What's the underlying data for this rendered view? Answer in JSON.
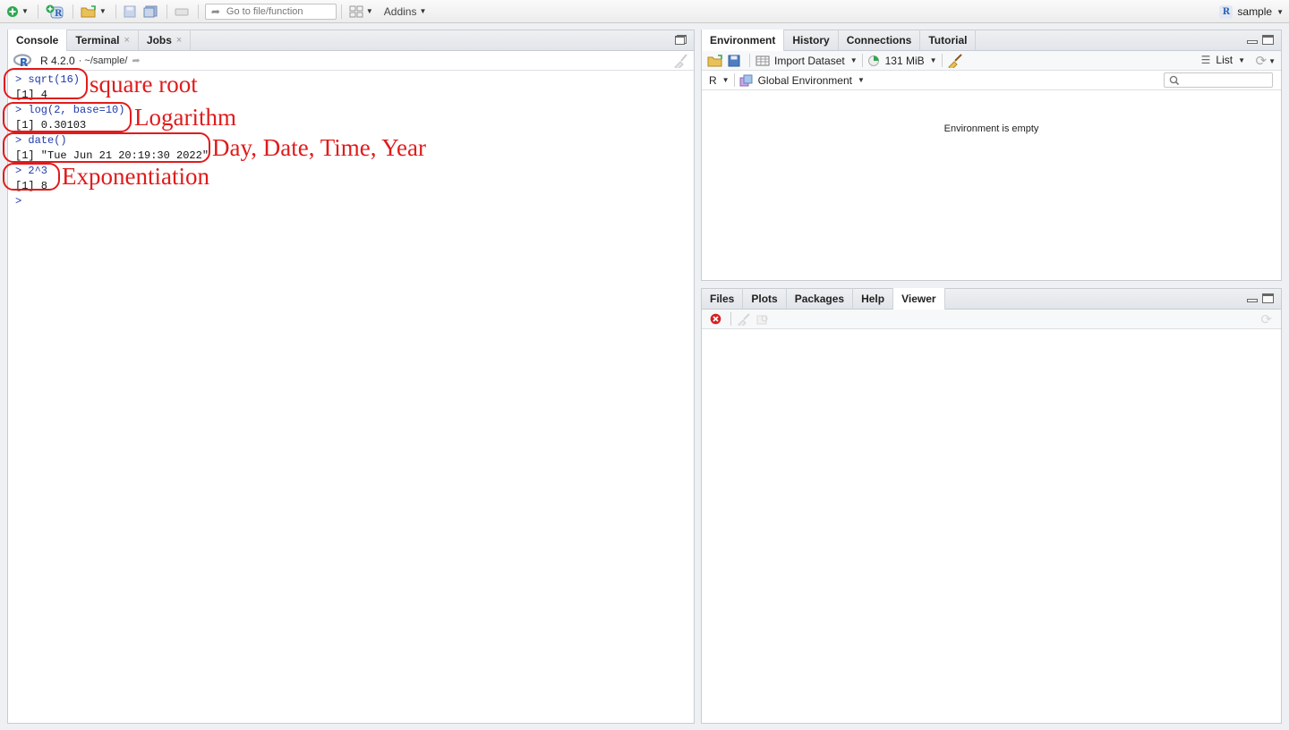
{
  "toolbar": {
    "goto_placeholder": "Go to file/function",
    "addins_label": "Addins",
    "project_label": "sample"
  },
  "console_pane": {
    "tabs": [
      {
        "label": "Console",
        "active": true
      },
      {
        "label": "Terminal",
        "close": "×"
      },
      {
        "label": "Jobs",
        "close": "×"
      }
    ],
    "r_version": "R 4.2.0",
    "working_dir": "· ~/sample/",
    "lines": [
      {
        "cmd": "> sqrt(16)",
        "out": "[1] 4"
      },
      {
        "cmd": "> log(2, base=10)",
        "out": "[1] 0.30103"
      },
      {
        "cmd": "> date()",
        "out": "[1] \"Tue Jun 21 20:19:30 2022\""
      },
      {
        "cmd": "> 2^3",
        "out": "[1] 8"
      }
    ],
    "prompt": ">",
    "annotations": [
      "square root",
      "Logarithm",
      "Day, Date, Time, Year",
      "Exponentiation"
    ]
  },
  "env_pane": {
    "tabs": [
      {
        "label": "Environment",
        "active": true
      },
      {
        "label": "History"
      },
      {
        "label": "Connections"
      },
      {
        "label": "Tutorial"
      }
    ],
    "import_label": "Import Dataset",
    "memory_label": "131 MiB",
    "view_mode": "List",
    "language": "R",
    "scope": "Global Environment",
    "empty_message": "Environment is empty"
  },
  "viewer_pane": {
    "tabs": [
      {
        "label": "Files"
      },
      {
        "label": "Plots"
      },
      {
        "label": "Packages"
      },
      {
        "label": "Help"
      },
      {
        "label": "Viewer",
        "active": true
      }
    ]
  },
  "colors": {
    "annotation_red": "#e01b1b",
    "console_command_blue": "#1f3aa8"
  }
}
